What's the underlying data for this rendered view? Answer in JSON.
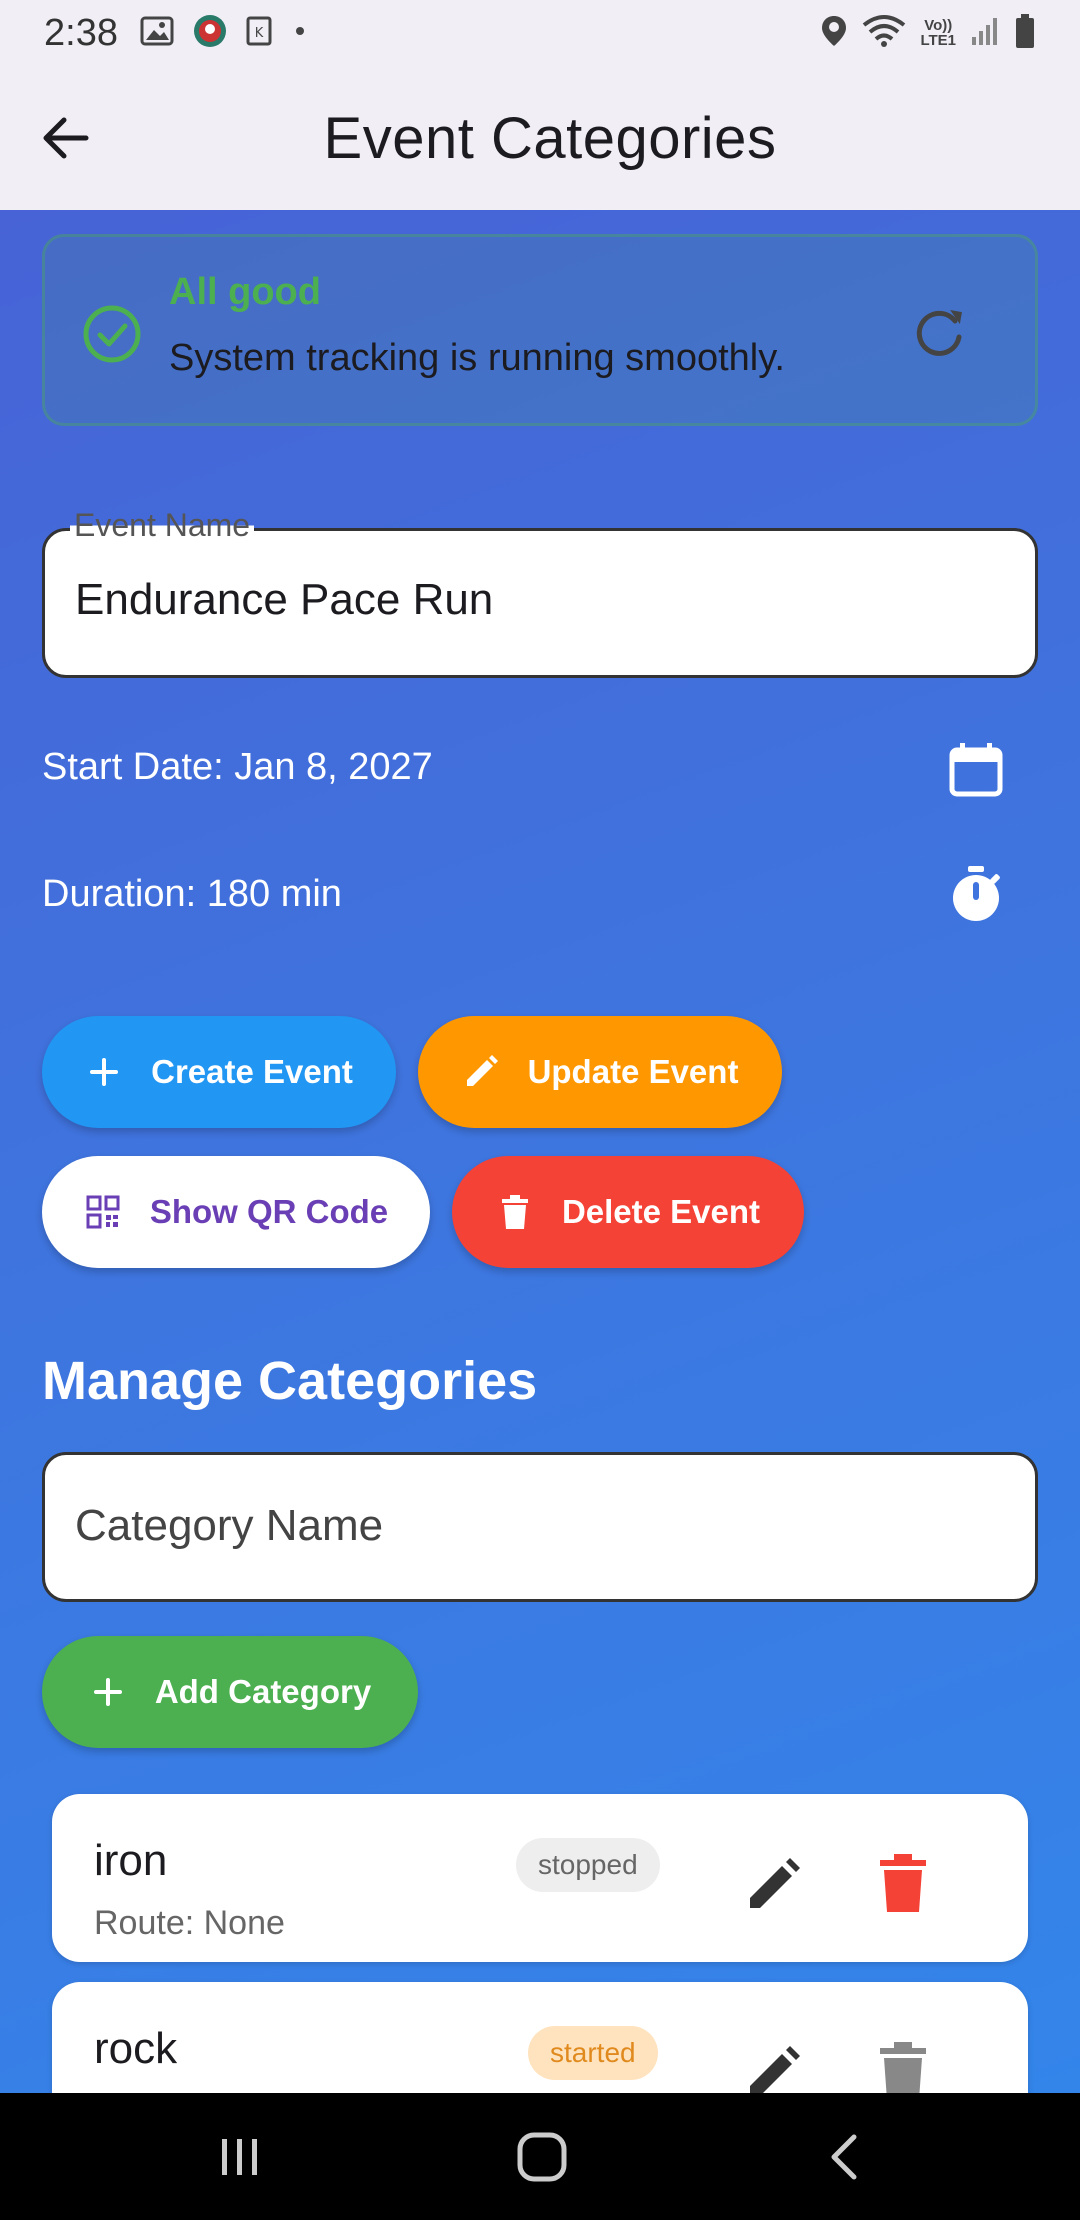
{
  "status_bar": {
    "time": "2:38",
    "network_label_top": "Vo))",
    "network_label_bottom": "LTE1",
    "icons": [
      "image-icon",
      "app-icon",
      "k-icon",
      "dot-icon",
      "location-icon",
      "wifi-icon",
      "signal-icon",
      "battery-icon"
    ]
  },
  "app_bar": {
    "title": "Event Categories",
    "back_icon": "arrow-back-icon"
  },
  "status_card": {
    "title": "All good",
    "message": "System tracking is running smoothly.",
    "colors": {
      "accent": "#4caf50"
    }
  },
  "event_form": {
    "name_label": "Event Name",
    "name_value": "Endurance Pace Run",
    "start_date": "Start Date: Jan 8, 2027",
    "duration": "Duration: 180 min"
  },
  "actions": {
    "create_label": "Create Event",
    "update_label": "Update Event",
    "qr_label": "Show QR Code",
    "delete_label": "Delete Event",
    "colors": {
      "create": "#2196f3",
      "update": "#ff9800",
      "qr_text": "#6a3fb5",
      "delete": "#f44336"
    }
  },
  "categories": {
    "section_title": "Manage Categories",
    "name_placeholder": "Category Name",
    "add_label": "Add Category",
    "add_color": "#4caf50",
    "items": [
      {
        "name": "iron",
        "route": "Route: None",
        "status": "stopped"
      },
      {
        "name": "rock",
        "route": "",
        "status": "started"
      }
    ]
  }
}
